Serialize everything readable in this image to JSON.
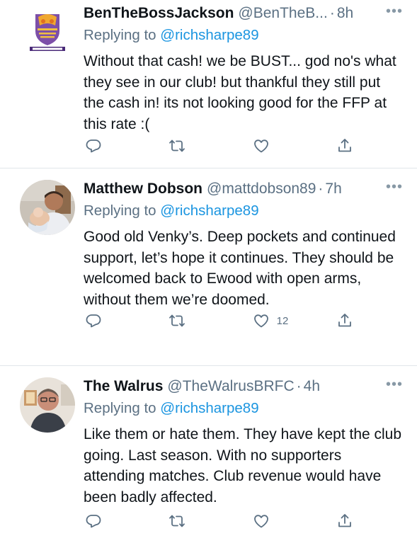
{
  "tweets": [
    {
      "name": "BenTheBossJackson",
      "handle": "@BenTheB...",
      "time": "8h",
      "reply_prefix": "Replying to",
      "reply_to": "@richsharpe89",
      "text": "Without that cash! we be BUST... god no's what they see in our club! but thankful they still put the cash in! its not looking good for the FFP at this rate :(",
      "likes": "",
      "avatar": "purple-crest-logo"
    },
    {
      "name": "Matthew Dobson",
      "handle": "@mattdobson89",
      "time": "7h",
      "reply_prefix": "Replying to",
      "reply_to": "@richsharpe89",
      "text": "Good old Venky’s. Deep pockets and continued support, let’s hope it continues. They should be welcomed back to Ewood with open arms, without them we’re doomed.",
      "likes": "12",
      "avatar": "person-photo"
    },
    {
      "name": "The Walrus",
      "handle": "@TheWalrusBRFC",
      "time": "4h",
      "reply_prefix": "Replying to",
      "reply_to": "@richsharpe89",
      "text": "Like them or hate them. They have kept the club going. Last season. With no supporters attending matches. Club revenue would have been badly affected.",
      "likes": "",
      "avatar": "person-photo"
    }
  ],
  "more_label": "•••",
  "separator": "·",
  "colors": {
    "text": "#0f1419",
    "secondary": "#5b7083",
    "link": "#1b95e0",
    "divider": "#e1e6ea"
  },
  "icons": [
    "reply-icon",
    "retweet-icon",
    "like-icon",
    "share-icon"
  ]
}
